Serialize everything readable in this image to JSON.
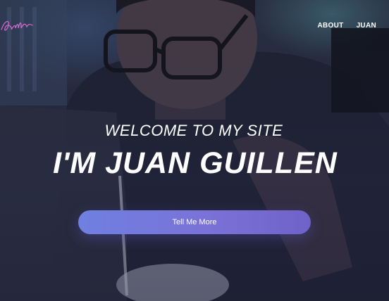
{
  "nav": {
    "items": [
      {
        "label": "ABOUT"
      },
      {
        "label": "JUAN"
      }
    ]
  },
  "hero": {
    "welcome": "WELCOME TO MY SITE",
    "name": "I'M JUAN GUILLEN",
    "cta_label": "Tell Me More"
  },
  "colors": {
    "accent_start": "#6f80e0",
    "accent_end": "#6f62c8",
    "logo": "#d86ad0",
    "text": "#ffffff"
  },
  "icons": {
    "logo": "signature-logo-icon"
  }
}
